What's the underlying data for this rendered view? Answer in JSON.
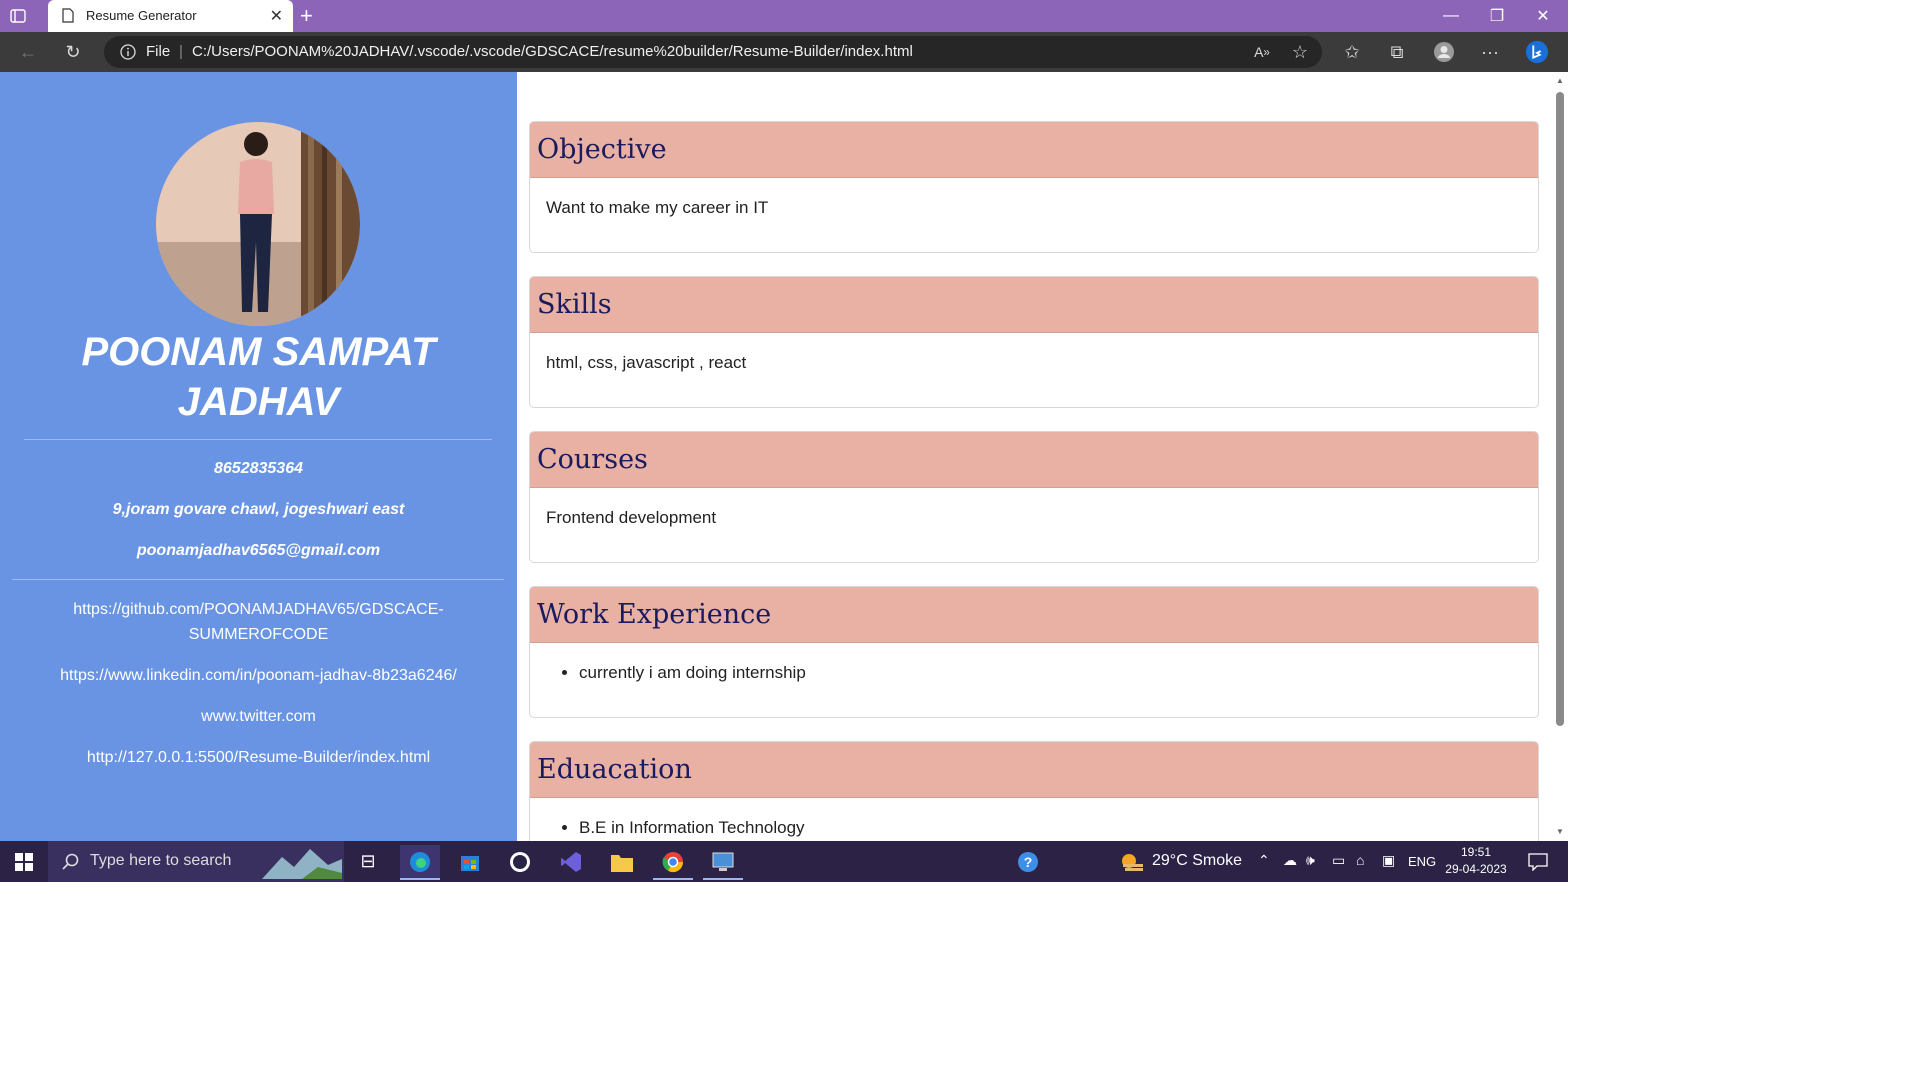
{
  "browser": {
    "tab_title": "Resume Generator",
    "address_prefix": "File",
    "url": "C:/Users/POONAM%20JADHAV/.vscode/.vscode/GDSCACE/resume%20builder/Resume-Builder/index.html",
    "accent": "#8c65b9"
  },
  "sidebar": {
    "name_line1": "POONAM SAMPAT",
    "name_line2": "JADHAV",
    "phone": "8652835364",
    "address": "9,joram govare chawl, jogeshwari east",
    "email": "poonamjadhav6565@gmail.com",
    "links": {
      "github_line1": "https://github.com/POONAMJADHAV65/GDSCACE-",
      "github_line2": "SUMMEROFCODE",
      "linkedin": "https://www.linkedin.com/in/poonam-jadhav-8b23a6246/",
      "twitter": "www.twitter.com",
      "portfolio": "http://127.0.0.1:5500/Resume-Builder/index.html"
    },
    "bg_color": "#6994e3"
  },
  "sections": {
    "objective": {
      "title": "Objective",
      "text": "Want to make my career in IT"
    },
    "skills": {
      "title": "Skills",
      "text": "html, css, javascript , react"
    },
    "courses": {
      "title": "Courses",
      "text": "Frontend development"
    },
    "work": {
      "title": "Work Experience",
      "item": "currently i am doing internship"
    },
    "education": {
      "title": "Eduacation",
      "item": "B.E in Information Technology"
    },
    "header_color": "#e8b1a4"
  },
  "taskbar": {
    "search_placeholder": "Type here to search",
    "weather": "29°C  Smoke",
    "lang": "ENG",
    "time": "19:51",
    "date": "29-04-2023"
  }
}
